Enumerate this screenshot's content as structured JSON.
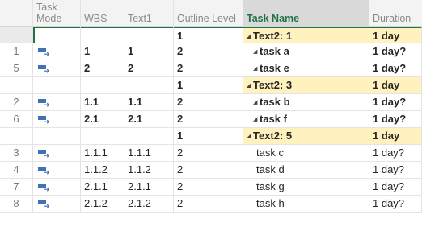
{
  "header": {
    "row_id": "",
    "task_mode": "Task Mode",
    "wbs": "WBS",
    "text1": "Text1",
    "outline_level": "Outline Level",
    "task_name": "Task Name",
    "duration": "Duration"
  },
  "rows": [
    {
      "id": "",
      "wbs": "",
      "text1": "",
      "outline": "1",
      "name": "Text2: 1",
      "duration": "1 day",
      "summary": true
    },
    {
      "id": "1",
      "wbs": "1",
      "text1": "1",
      "outline": "2",
      "name": "task a",
      "duration": "1 day?",
      "summary": false
    },
    {
      "id": "5",
      "wbs": "2",
      "text1": "2",
      "outline": "2",
      "name": "task e",
      "duration": "1 day?",
      "summary": false
    },
    {
      "id": "",
      "wbs": "",
      "text1": "",
      "outline": "1",
      "name": "Text2: 3",
      "duration": "1 day",
      "summary": true
    },
    {
      "id": "2",
      "wbs": "1.1",
      "text1": "1.1",
      "outline": "2",
      "name": "task b",
      "duration": "1 day?",
      "summary": false
    },
    {
      "id": "6",
      "wbs": "2.1",
      "text1": "2.1",
      "outline": "2",
      "name": "task f",
      "duration": "1 day?",
      "summary": false
    },
    {
      "id": "",
      "wbs": "",
      "text1": "",
      "outline": "1",
      "name": "Text2: 5",
      "duration": "1 day",
      "summary": true
    },
    {
      "id": "3",
      "wbs": "1.1.1",
      "text1": "1.1.1",
      "outline": "2",
      "name": "task c",
      "duration": "1 day?",
      "summary": false
    },
    {
      "id": "4",
      "wbs": "1.1.2",
      "text1": "1.1.2",
      "outline": "2",
      "name": "task d",
      "duration": "1 day?",
      "summary": false
    },
    {
      "id": "7",
      "wbs": "2.1.1",
      "text1": "2.1.1",
      "outline": "2",
      "name": "task g",
      "duration": "1 day?",
      "summary": false
    },
    {
      "id": "8",
      "wbs": "2.1.2",
      "text1": "2.1.2",
      "outline": "2",
      "name": "task h",
      "duration": "1 day?",
      "summary": false
    }
  ],
  "icons": {
    "task_mode": "auto-schedule-task-icon",
    "collapse": "collapse-triangle-icon"
  },
  "colors": {
    "summary_fill": "#fff2bf",
    "accent_green": "#217346",
    "task_icon_blue": "#3f73b5"
  }
}
